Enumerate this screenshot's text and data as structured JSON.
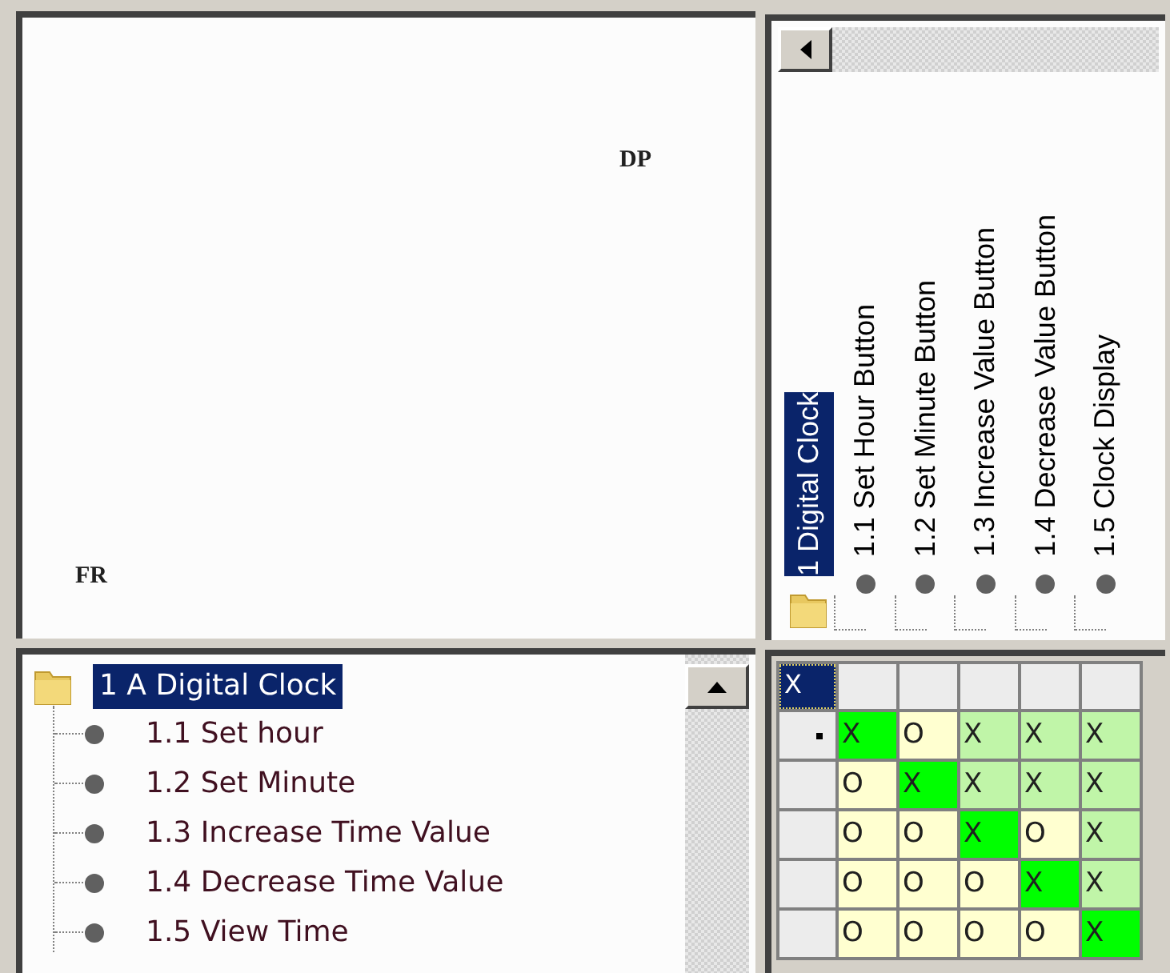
{
  "design_canvas": {
    "labels": [
      {
        "text": "DP"
      },
      {
        "text": "FR"
      }
    ]
  },
  "column_tree": {
    "root": {
      "label": "1 Digital Clock",
      "selected": true
    },
    "children": [
      {
        "label": "1.1 Set Hour Button",
        "selected": false
      },
      {
        "label": "1.2 Set Minute Button",
        "selected": false
      },
      {
        "label": "1.3 Increase Value Button",
        "selected": false
      },
      {
        "label": "1.4 Decrease Value Button",
        "selected": false
      },
      {
        "label": "1.5 Clock Display",
        "selected": false
      }
    ]
  },
  "matrix": {
    "corner": "X",
    "rows": [
      {
        "current": true,
        "cells": [
          {
            "text": "X",
            "color": "#00ff00"
          },
          {
            "text": "O",
            "color": "#ffffd0"
          },
          {
            "text": "X",
            "color": "#c0f5a8"
          },
          {
            "text": "X",
            "color": "#c0f5a8"
          },
          {
            "text": "X",
            "color": "#c0f5a8"
          }
        ]
      },
      {
        "current": false,
        "cells": [
          {
            "text": "O",
            "color": "#ffffd0"
          },
          {
            "text": "X",
            "color": "#00ff00"
          },
          {
            "text": "X",
            "color": "#c0f5a8"
          },
          {
            "text": "X",
            "color": "#c0f5a8"
          },
          {
            "text": "X",
            "color": "#c0f5a8"
          }
        ]
      },
      {
        "current": false,
        "cells": [
          {
            "text": "O",
            "color": "#ffffd0"
          },
          {
            "text": "O",
            "color": "#ffffd0"
          },
          {
            "text": "X",
            "color": "#00ff00"
          },
          {
            "text": "O",
            "color": "#ffffd0"
          },
          {
            "text": "X",
            "color": "#c0f5a8"
          }
        ]
      },
      {
        "current": false,
        "cells": [
          {
            "text": "O",
            "color": "#ffffd0"
          },
          {
            "text": "O",
            "color": "#ffffd0"
          },
          {
            "text": "O",
            "color": "#ffffd0"
          },
          {
            "text": "X",
            "color": "#00ff00"
          },
          {
            "text": "X",
            "color": "#c0f5a8"
          }
        ]
      },
      {
        "current": false,
        "cells": [
          {
            "text": "O",
            "color": "#ffffd0"
          },
          {
            "text": "O",
            "color": "#ffffd0"
          },
          {
            "text": "O",
            "color": "#ffffd0"
          },
          {
            "text": "O",
            "color": "#ffffd0"
          },
          {
            "text": "X",
            "color": "#00ff00"
          }
        ]
      }
    ]
  },
  "tree": {
    "root": {
      "label": "1 A Digital Clock",
      "selected": true,
      "children": [
        {
          "label": "1.1 Set hour",
          "selected": false
        },
        {
          "label": "1.2 Set Minute",
          "selected": false
        },
        {
          "label": "1.3 Increase Time Value",
          "selected": false
        },
        {
          "label": "1.4 Decrease Time Value",
          "selected": false
        },
        {
          "label": "1.5 View Time",
          "selected": false
        }
      ]
    }
  }
}
